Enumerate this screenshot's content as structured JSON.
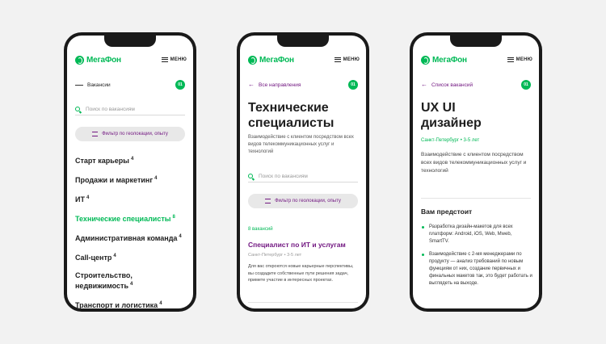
{
  "brand": {
    "logo_text": "МегаФон",
    "menu_label": "МЕНЮ",
    "accent": "#00b956",
    "link_color": "#731982"
  },
  "phone1": {
    "crumb": "Вакансии",
    "badge": "01",
    "search_placeholder": "Поиск по вакансиям",
    "filter_label": "Фильтр по геолокации, опыту",
    "categories": [
      {
        "label": "Старт карьеры",
        "count": "4"
      },
      {
        "label": "Продажи и маркетинг",
        "count": "4"
      },
      {
        "label": "ИТ",
        "count": "4"
      },
      {
        "label": "Технические специалисты",
        "count": "8",
        "active": true
      },
      {
        "label": "Административная команда",
        "count": "4"
      },
      {
        "label": "Call-центр",
        "count": "4"
      },
      {
        "label": "Строительство, недвижимость",
        "count": "4"
      },
      {
        "label": "Транспорт и логистика",
        "count": "4"
      }
    ]
  },
  "phone2": {
    "crumb": "Все направления",
    "badge": "01",
    "title": "Технические специалисты",
    "description": "Взаимодействие с клиентом посредством всех видов телекоммуникационных услуг и технологий",
    "search_placeholder": "Поиск по вакансиям",
    "filter_label": "Фильтр по геолокации, опыту",
    "vacancies_count": "8 вакансий",
    "job_title": "Специалист по ИТ и услугам",
    "job_meta": "Санкт-Петербург • 3-5 лет",
    "job_text": "Для вас откроются новые карьерные перспективы, вы создадите собственные пути решения задач, примете участие в интересных проектах."
  },
  "phone3": {
    "crumb": "Список вакансий",
    "badge": "01",
    "title": "UX UI дизайнер",
    "city": "Санкт-Петербург • 3-5 лет",
    "description": "Взаимодействие с клиентом посредством всех видов телекоммуникационных услуг и технологий",
    "section_title": "Вам предстоит",
    "bullets": [
      "Разработка дизайн-макетов для всех платформ: Android, iOS, Web, Mweb, SmartTV.",
      "Взаимодействие с 2-мя менеджерами по продукту — анализ требований по новым функциям от них, создание первичных и финальных макетов так, это будет работать и выглядеть на выходе."
    ]
  }
}
